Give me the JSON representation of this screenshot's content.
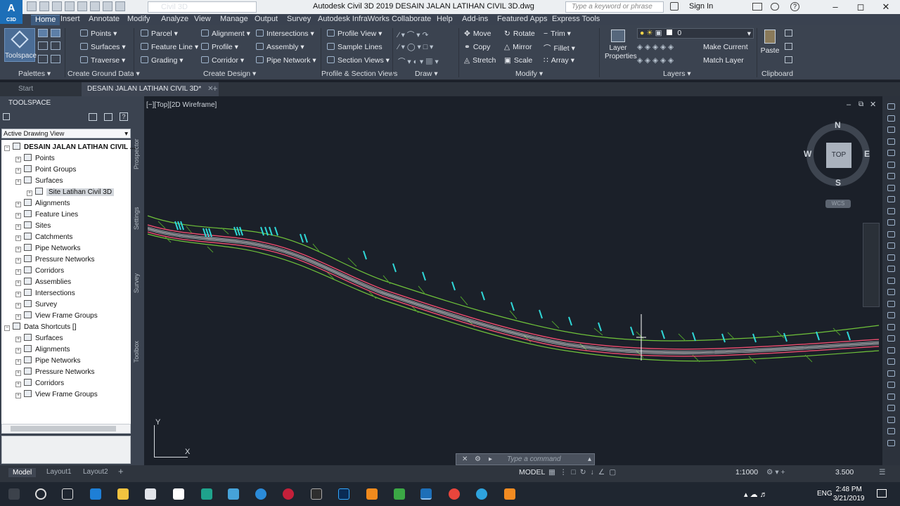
{
  "app": {
    "logo": "A",
    "logo_sub": "C3D",
    "workspace": "Civil 3D",
    "title": "Autodesk Civil 3D 2019    DESAIN JALAN LATIHAN CIVIL 3D.dwg",
    "search_placeholder": "Type a keyword or phrase",
    "sign_in": "Sign In"
  },
  "tabs": [
    "Home",
    "Insert",
    "Annotate",
    "Modify",
    "Analyze",
    "View",
    "Manage",
    "Output",
    "Survey",
    "Autodesk InfraWorks",
    "Collaborate",
    "Help",
    "Add-ins",
    "Featured Apps",
    "Express Tools"
  ],
  "active_tab": "Home",
  "ribbon": {
    "toolspace": "Toolspace",
    "palettes": "Palettes",
    "ground": [
      "Points",
      "Surfaces",
      "Traverse"
    ],
    "ground_group": "Create Ground Data",
    "design_col1": [
      "Parcel",
      "Feature Line",
      "Grading"
    ],
    "design_col2": [
      "Alignment",
      "Profile",
      "Corridor"
    ],
    "design_col3": [
      "Intersections",
      "Assembly",
      "Pipe Network"
    ],
    "design_group": "Create Design",
    "profile_items": [
      "Profile View",
      "Sample Lines",
      "Section Views"
    ],
    "profile_group": "Profile & Section Views",
    "draw_group": "Draw",
    "modify_col1": [
      "Move",
      "Copy",
      "Stretch"
    ],
    "modify_col2": [
      "Rotate",
      "Mirror",
      "Scale"
    ],
    "modify_col3": [
      "Trim",
      "Fillet",
      "Array"
    ],
    "modify_group": "Modify",
    "layer_properties": "Layer Properties",
    "layer_value": "0",
    "make_current": "Make Current",
    "match_layer": "Match Layer",
    "layers_group": "Layers",
    "paste": "Paste",
    "clipboard_group": "Clipboard"
  },
  "file_tabs": [
    "Start",
    "DESAIN JALAN LATIHAN CIVIL 3D*"
  ],
  "toolspace": {
    "header": "TOOLSPACE",
    "view": "Active Drawing View",
    "tabs": [
      "Prospector",
      "Settings",
      "Survey",
      "Toolbox"
    ],
    "tree": [
      {
        "label": "DESAIN JALAN LATIHAN CIVIL ...",
        "level": 0,
        "bold": true
      },
      {
        "label": "Points",
        "level": 1
      },
      {
        "label": "Point Groups",
        "level": 1
      },
      {
        "label": "Surfaces",
        "level": 1
      },
      {
        "label": "Site Latihan Civil 3D",
        "level": 2,
        "selected": true
      },
      {
        "label": "Alignments",
        "level": 1
      },
      {
        "label": "Feature Lines",
        "level": 1
      },
      {
        "label": "Sites",
        "level": 1
      },
      {
        "label": "Catchments",
        "level": 1
      },
      {
        "label": "Pipe Networks",
        "level": 1
      },
      {
        "label": "Pressure Networks",
        "level": 1
      },
      {
        "label": "Corridors",
        "level": 1
      },
      {
        "label": "Assemblies",
        "level": 1
      },
      {
        "label": "Intersections",
        "level": 1
      },
      {
        "label": "Survey",
        "level": 1
      },
      {
        "label": "View Frame Groups",
        "level": 1
      },
      {
        "label": "Data Shortcuts []",
        "level": 0
      },
      {
        "label": "Surfaces",
        "level": 1
      },
      {
        "label": "Alignments",
        "level": 1
      },
      {
        "label": "Pipe Networks",
        "level": 1
      },
      {
        "label": "Pressure Networks",
        "level": 1
      },
      {
        "label": "Corridors",
        "level": 1
      },
      {
        "label": "View Frame Groups",
        "level": 1
      }
    ]
  },
  "viewport": {
    "label": "[−][Top][2D Wireframe]",
    "viewcube": {
      "n": "N",
      "s": "S",
      "e": "E",
      "w": "W",
      "top": "TOP",
      "wcs": "WCS"
    },
    "ucs_y": "Y",
    "ucs_x": "X"
  },
  "command_placeholder": "Type a command",
  "layout_tabs": [
    "Model",
    "Layout1",
    "Layout2"
  ],
  "status": {
    "model": "MODEL",
    "scale": "1:1000",
    "zoom": "3.500"
  },
  "taskbar": {
    "lang": "ENG",
    "time": "2:48 PM",
    "date": "3/21/2019"
  },
  "colors": {
    "accent": "#3e5b7e",
    "road_edge": "#e04a6a",
    "road_center": "#e8e8e8",
    "grading": "#6fc23a",
    "cross_section": "#2fd6d6"
  }
}
